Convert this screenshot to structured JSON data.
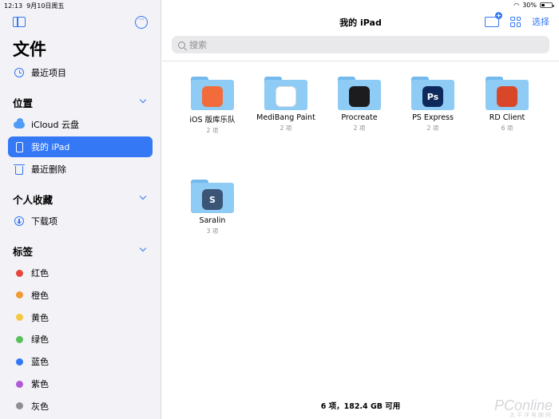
{
  "status_bar": {
    "time": "12:13",
    "date": "9月10日周五",
    "battery": "30%"
  },
  "sidebar": {
    "title": "文件",
    "recents_label": "最近项目",
    "sections": {
      "locations": "位置",
      "favorites": "个人收藏",
      "tags": "标签"
    },
    "locations": [
      {
        "label": "iCloud 云盘",
        "icon": "cloud-icon"
      },
      {
        "label": "我的 iPad",
        "icon": "ipad-icon",
        "active": true
      },
      {
        "label": "最近删除",
        "icon": "trash-icon"
      }
    ],
    "favorites": [
      {
        "label": "下载项",
        "icon": "download-icon"
      }
    ],
    "tags": [
      {
        "label": "红色",
        "color": "#e8453c"
      },
      {
        "label": "橙色",
        "color": "#f19a37"
      },
      {
        "label": "黄色",
        "color": "#f5c842"
      },
      {
        "label": "绿色",
        "color": "#5ac05a"
      },
      {
        "label": "蓝色",
        "color": "#3478f6"
      },
      {
        "label": "紫色",
        "color": "#b05bd8"
      },
      {
        "label": "灰色",
        "color": "#8e8e93"
      }
    ]
  },
  "main": {
    "title": "我的 iPad",
    "select_label": "选择",
    "search_placeholder": "搜索",
    "folders": [
      {
        "name": "iOS 版库乐队",
        "count": "2 项",
        "app_icon": "garageband-icon",
        "app_color": "#f26b3a"
      },
      {
        "name": "MediBang Paint",
        "count": "2 项",
        "app_icon": "medibang-icon",
        "app_color": "#ffffff"
      },
      {
        "name": "Procreate",
        "count": "2 项",
        "app_icon": "procreate-icon",
        "app_color": "#1c1c1e"
      },
      {
        "name": "PS Express",
        "count": "2 项",
        "app_icon": "ps-express-icon",
        "app_color": "#0e2a5c",
        "app_text": "Ps"
      },
      {
        "name": "RD Client",
        "count": "6 项",
        "app_icon": "rd-client-icon",
        "app_color": "#d9472b"
      },
      {
        "name": "Saralin",
        "count": "3 项",
        "app_icon": "saralin-icon",
        "app_color": "#3b5577",
        "app_text": "S"
      }
    ],
    "footer": "6 项，182.4 GB 可用"
  },
  "watermark": {
    "brand": "PConline",
    "sub": "太平洋电脑网"
  }
}
